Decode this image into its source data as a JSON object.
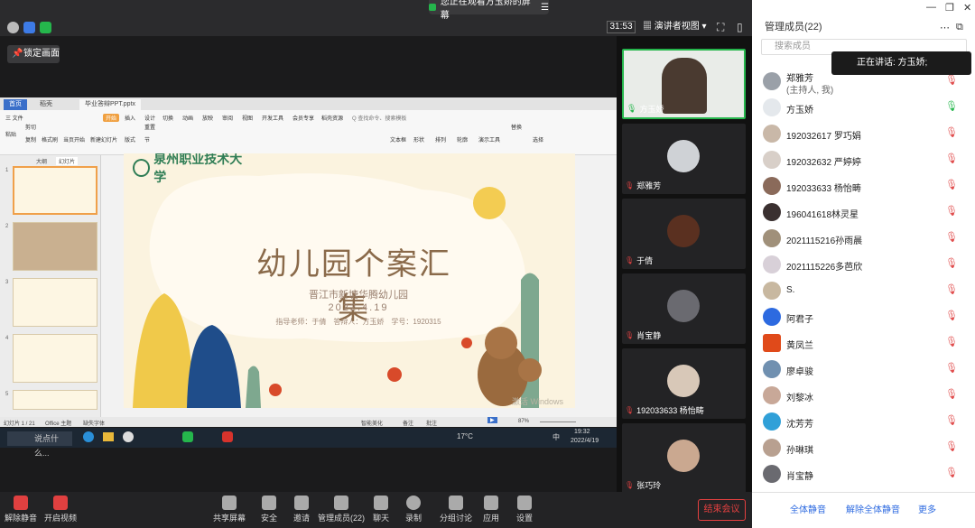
{
  "topbar": {
    "share_banner": "您正在观看方玉娇的屏幕",
    "timer": "31:53",
    "view_mode": "演讲者视图",
    "panel_title": "管理成员(22)"
  },
  "stage": {
    "lock_label": "锁定画面",
    "wps": {
      "tabs": [
        "首页",
        "稻壳",
        "毕业答辩PPT.pptx"
      ],
      "menu": [
        "三 文件",
        "开始",
        "插入",
        "设计",
        "切换",
        "动画",
        "放映",
        "审阅",
        "视图",
        "开发工具",
        "会员专享",
        "稻壳资源",
        "Q 查找命令、搜索模板"
      ],
      "ribbon": [
        "粘贴",
        "剪切",
        "复制",
        "格式刷",
        "当页开始",
        "新建幻灯片",
        "版式",
        "节",
        "重置",
        "文本框",
        "形状",
        "排列",
        "轮廓",
        "演示工具",
        "替换",
        "选择"
      ],
      "pane_tabs": [
        "大纲",
        "幻灯片"
      ],
      "status_left": "幻灯片 1 / 21",
      "status_theme": "Office 主题",
      "status_font": "缺失字体",
      "status_zoom": "87%",
      "status_notes": "智能美化",
      "status_comment": "备注",
      "status_review": "批注"
    },
    "slide": {
      "school": "泉州职业技术大学",
      "title": "幼儿园个案汇集",
      "subtitle": "晋江市新塘华腾幼儿园",
      "date": "2022.4.19",
      "meta": "指导老师：于倩　答辩人：方玉娇　学号：1920315",
      "watermark": "激活 Windows"
    },
    "taskbar": {
      "search": "说点什么...",
      "temp": "17°C",
      "time": "19:32",
      "date": "2022/4/19",
      "lang": "中"
    }
  },
  "videos": [
    {
      "name": "方玉娇",
      "active": true
    },
    {
      "name": "郑雅芳",
      "active": false
    },
    {
      "name": "于倩",
      "active": false
    },
    {
      "name": "肖宝静",
      "active": false
    },
    {
      "name": "192033633 杨怡畴",
      "active": false
    },
    {
      "name": "张巧玲",
      "active": false
    }
  ],
  "panel": {
    "search_placeholder": "搜索成员",
    "speaking": "正在讲话: 方玉娇;",
    "members": [
      {
        "name": "郑雅芳",
        "sub": "(主持人, 我)"
      },
      {
        "name": "方玉娇",
        "sub": ""
      },
      {
        "name": "192032617 罗巧娟",
        "sub": ""
      },
      {
        "name": "192032632 严婷婷",
        "sub": ""
      },
      {
        "name": "192033633 杨怡畴",
        "sub": ""
      },
      {
        "name": "196041618林灵星",
        "sub": ""
      },
      {
        "name": "2021115216孙雨晨",
        "sub": ""
      },
      {
        "name": "2021115226多芭欣",
        "sub": ""
      },
      {
        "name": "S.",
        "sub": ""
      },
      {
        "name": "阿君子",
        "sub": ""
      },
      {
        "name": "黄凤兰",
        "sub": ""
      },
      {
        "name": "廖卓骏",
        "sub": ""
      },
      {
        "name": "刘黎冰",
        "sub": ""
      },
      {
        "name": "沈芳芳",
        "sub": ""
      },
      {
        "name": "孙琳琪",
        "sub": ""
      },
      {
        "name": "肖宝静",
        "sub": ""
      }
    ],
    "mute_all": "全体静音",
    "unmute_all": "解除全体静音",
    "more": "更多"
  },
  "bottombar": {
    "unmute": "解除静音",
    "video": "开启视频",
    "share": "共享屏幕",
    "security": "安全",
    "invite": "邀请",
    "members": "管理成员(22)",
    "chat": "聊天",
    "record": "录制",
    "breakout": "分组讨论",
    "apps": "应用",
    "settings": "设置",
    "end": "结束会议"
  },
  "colors": {
    "accent": "#2d6ae0",
    "danger": "#e54040",
    "slide_title": "#8a6a4a",
    "school_green": "#2f7d55"
  }
}
